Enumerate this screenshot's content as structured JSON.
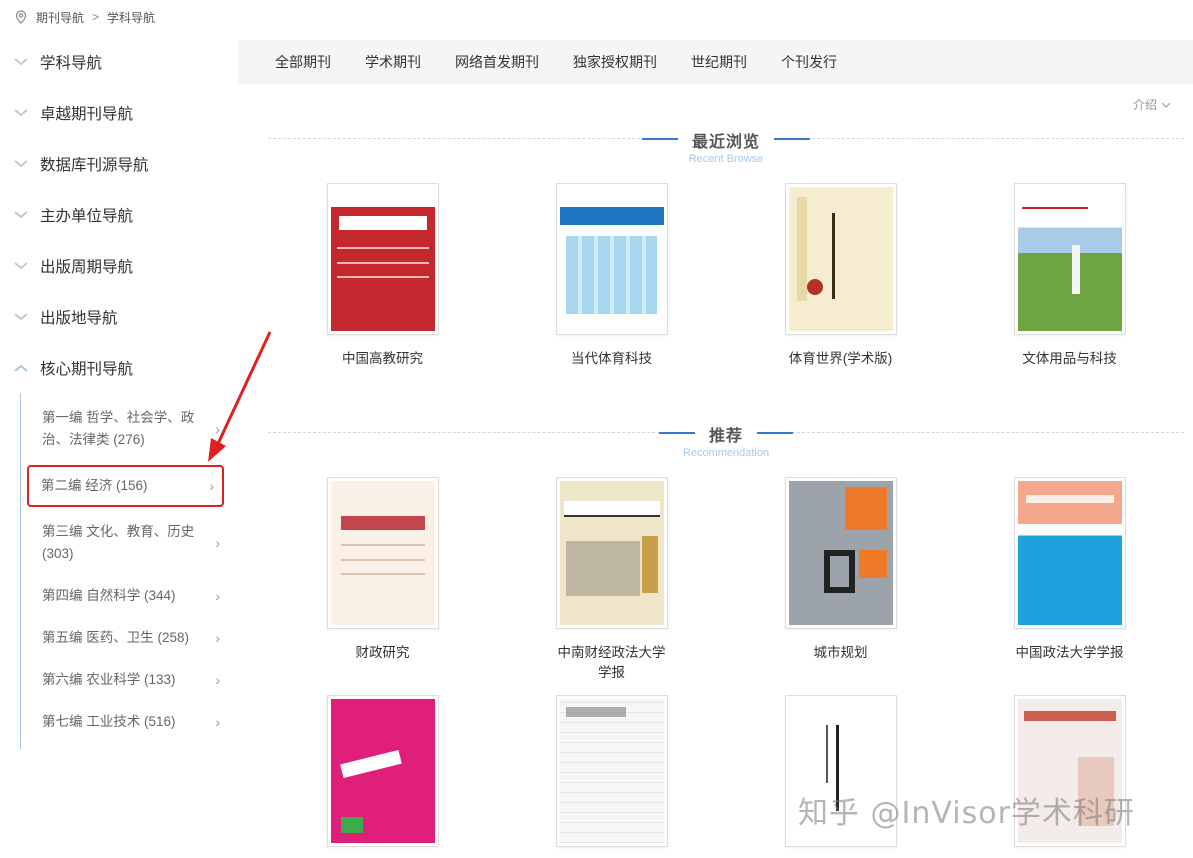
{
  "breadcrumb": {
    "items": [
      "期刊导航",
      "学科导航"
    ],
    "separator": ">"
  },
  "sidenav": {
    "items": [
      "学科导航",
      "卓越期刊导航",
      "数据库刊源导航",
      "主办单位导航",
      "出版周期导航",
      "出版地导航"
    ],
    "expanded": "核心期刊导航",
    "subitems": [
      "第一编 哲学、社会学、政治、法律类 (276)",
      "第二编 经济 (156)",
      "第三编 文化、教育、历史 (303)",
      "第四编 自然科学 (344)",
      "第五编 医药、卫生 (258)",
      "第六编 农业科学 (133)",
      "第七编 工业技术 (516)"
    ]
  },
  "tabs": [
    "全部期刊",
    "学术期刊",
    "网络首发期刊",
    "独家授权期刊",
    "世纪期刊",
    "个刊发行"
  ],
  "intro_label": "介绍",
  "recent": {
    "title": "最近浏览",
    "subtitle": "Recent Browse",
    "journals": [
      "中国高教研究",
      "当代体育科技",
      "体育世界(学术版)",
      "文体用品与科技"
    ]
  },
  "recommend": {
    "title": "推荐",
    "subtitle": "Recommendation",
    "journals": [
      "财政研究",
      "中南财经政法大学学报",
      "城市规划",
      "中国政法大学学报"
    ],
    "journals_row3": [
      "",
      "",
      "",
      ""
    ]
  },
  "watermark": "知乎 @InVisor学术科研",
  "colors": {
    "accent": "#3a78d6",
    "highlight_border": "#e02020"
  }
}
